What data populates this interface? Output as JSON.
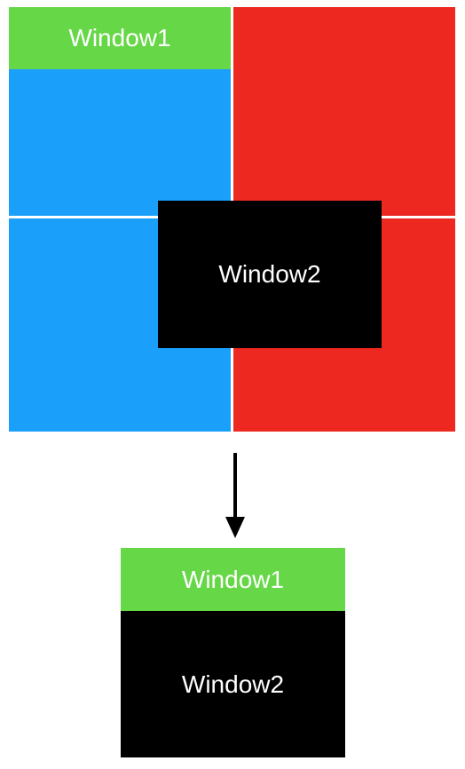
{
  "colors": {
    "green": "#66d747",
    "blue": "#1a9ffb",
    "red": "#ec2820",
    "black": "#000000",
    "white": "#ffffff"
  },
  "top": {
    "window1_label": "Window1",
    "window2_label": "Window2"
  },
  "bottom": {
    "window1_label": "Window1",
    "window2_label": "Window2"
  }
}
